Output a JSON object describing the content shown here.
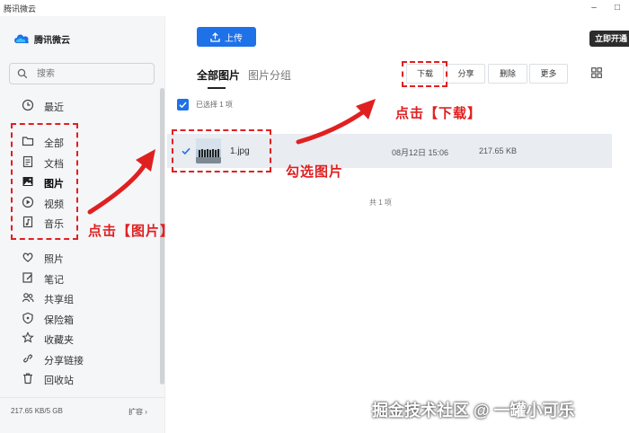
{
  "window": {
    "title": "腾讯微云",
    "minimize": "–",
    "maximize": "□"
  },
  "sidebar": {
    "logo_text": "腾讯微云",
    "search_placeholder": "搜索",
    "items": [
      {
        "label": "最近",
        "icon": "clock-icon"
      },
      {
        "label": "全部",
        "icon": "folder-icon"
      },
      {
        "label": "文档",
        "icon": "document-icon"
      },
      {
        "label": "图片",
        "icon": "image-icon",
        "active": true
      },
      {
        "label": "视频",
        "icon": "play-icon"
      },
      {
        "label": "音乐",
        "icon": "music-icon"
      },
      {
        "label": "照片",
        "icon": "photo-icon"
      },
      {
        "label": "笔记",
        "icon": "note-icon"
      },
      {
        "label": "共享组",
        "icon": "group-icon"
      },
      {
        "label": "保险箱",
        "icon": "safe-icon"
      },
      {
        "label": "收藏夹",
        "icon": "star-icon"
      },
      {
        "label": "分享链接",
        "icon": "share-link-icon"
      },
      {
        "label": "回收站",
        "icon": "trash-icon"
      }
    ],
    "storage": "217.65 KB/5 GB",
    "expand": "扩容 ›"
  },
  "toolbar": {
    "upload": "上传",
    "vip": "立即开通",
    "tabs": [
      "全部图片",
      "图片分组"
    ],
    "download": "下载",
    "share": "分享",
    "delete": "删除",
    "more": "更多"
  },
  "selection": {
    "text": "已选择 1 项"
  },
  "files": [
    {
      "name": "1.jpg",
      "date": "08月12日 15:06",
      "size": "217.65 KB"
    }
  ],
  "total": "共 1 项",
  "annotations": {
    "click_image": "点击【图片】",
    "check_image": "勾选图片",
    "click_download": "点击【下载】"
  },
  "watermark": "掘金技术社区 @ 一罐小可乐",
  "colors": {
    "accent": "#1f71e8",
    "annotation": "#e02020",
    "vip": "#2c2c2c"
  }
}
